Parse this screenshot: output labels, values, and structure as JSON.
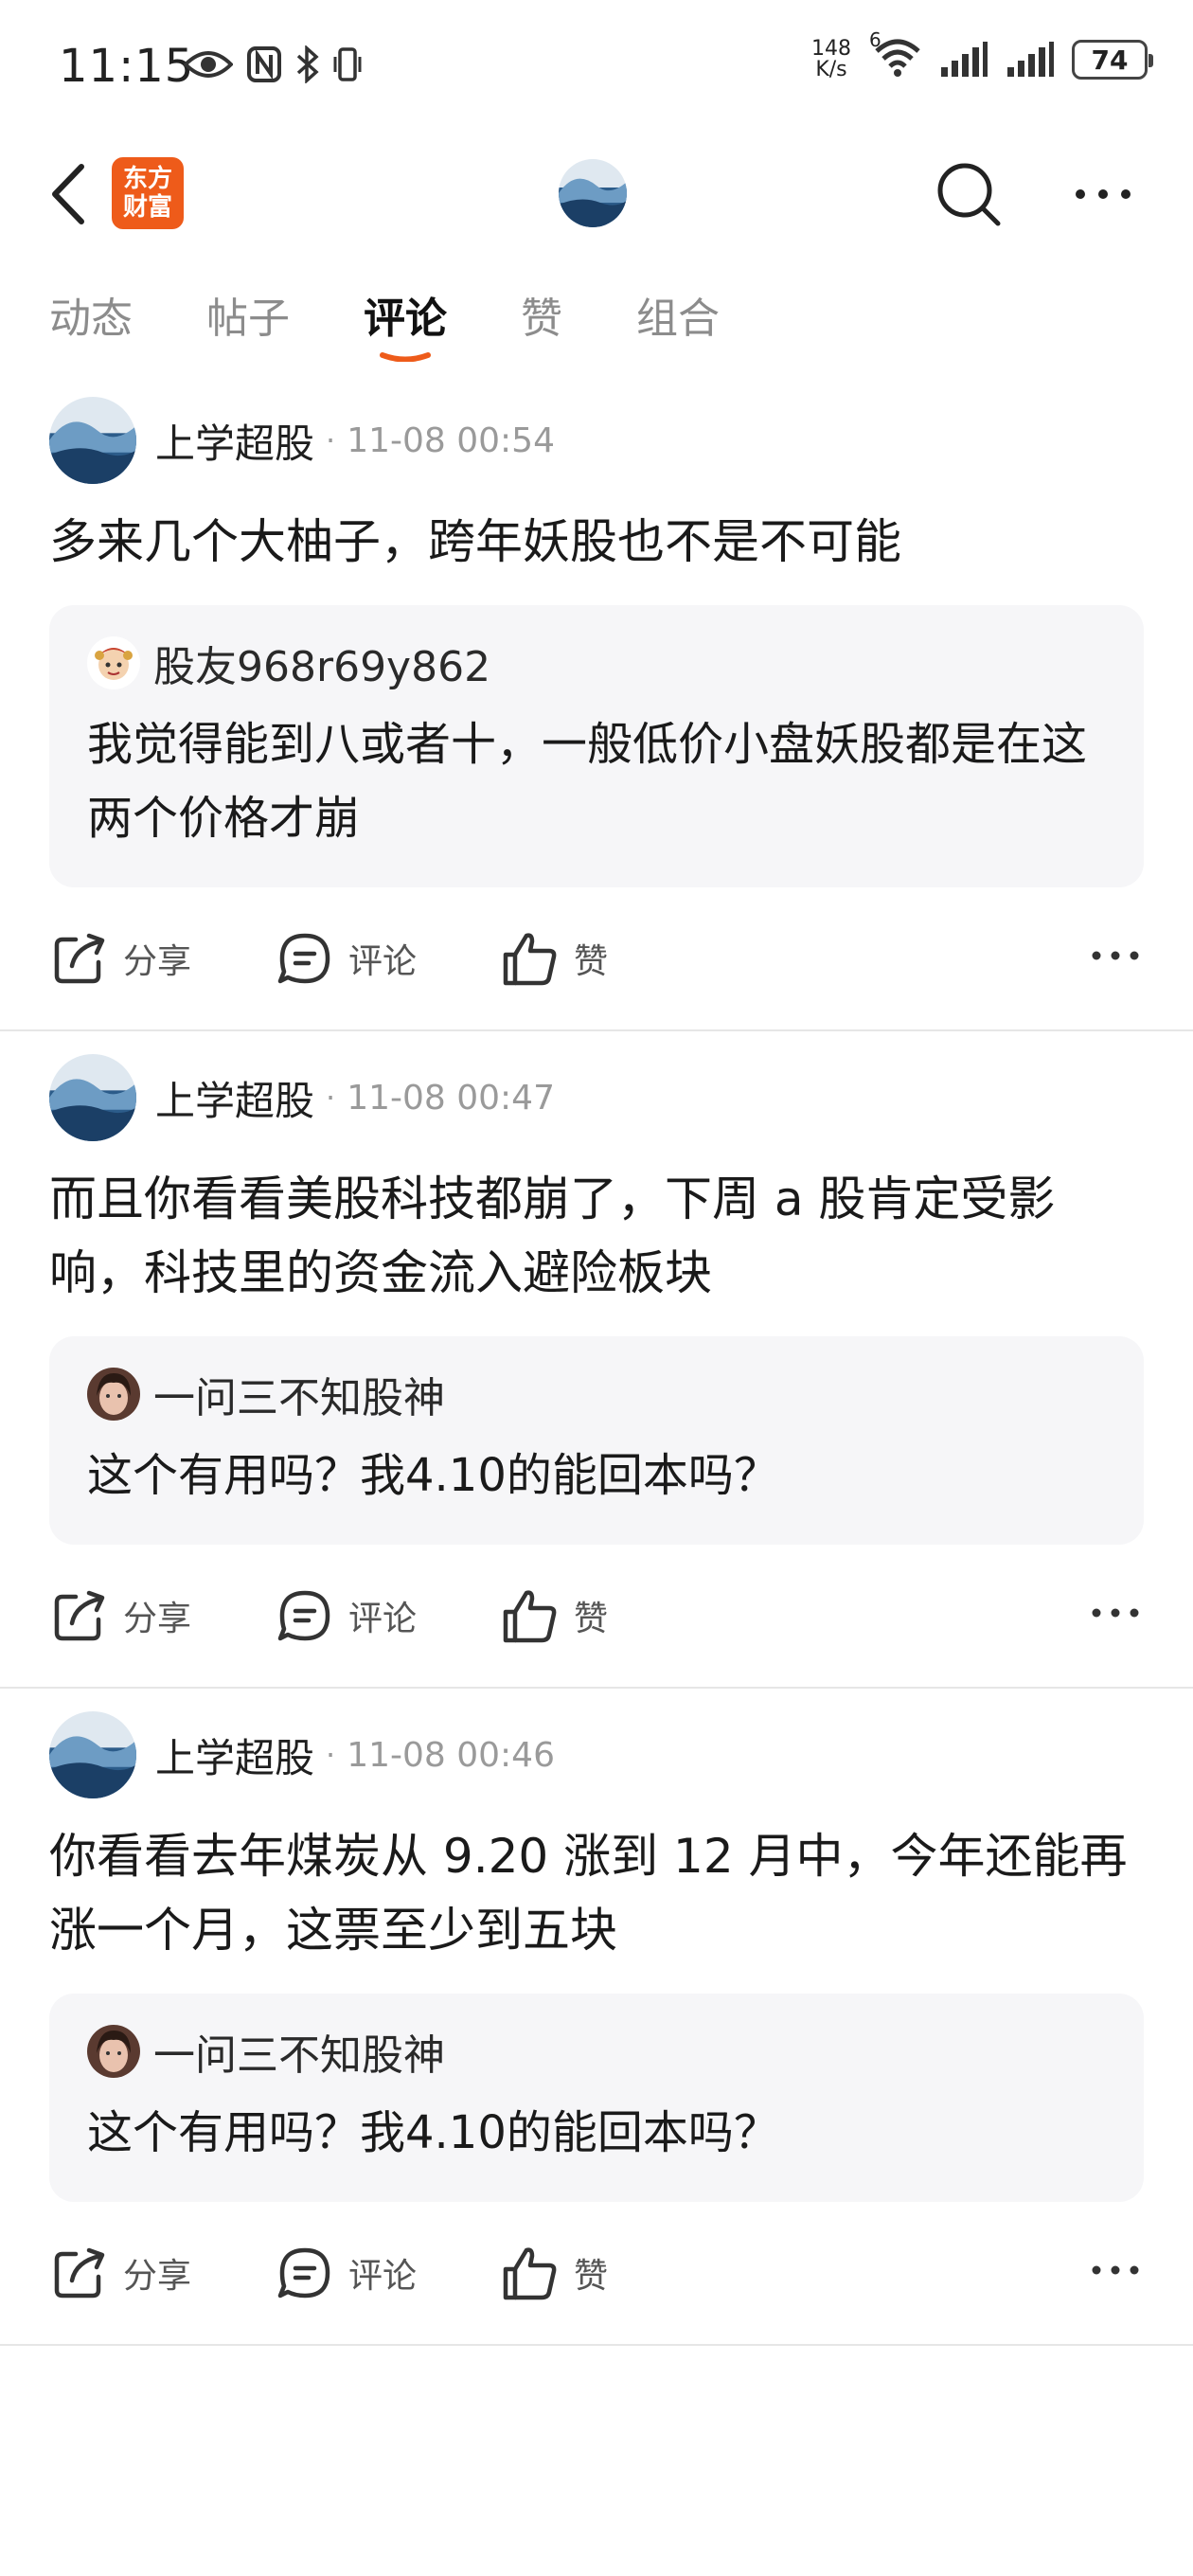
{
  "status_bar": {
    "time": "11:15",
    "net_speed_top": "148",
    "net_speed_bottom": "K/s",
    "wifi_badge": "6",
    "battery": "74"
  },
  "nav": {
    "logo_line1": "东方",
    "logo_line2": "财富"
  },
  "tabs": [
    {
      "label": "动态"
    },
    {
      "label": "帖子"
    },
    {
      "label": "评论"
    },
    {
      "label": "赞"
    },
    {
      "label": "组合"
    }
  ],
  "active_tab": "评论",
  "accent_color": "#ee5b1a",
  "actions": {
    "share": "分享",
    "comment": "评论",
    "like": "赞"
  },
  "posts": [
    {
      "author": "上学超股",
      "dot": "·",
      "time": "11-08 00:54",
      "text": "多来几个大柚子，跨年妖股也不是不可能",
      "quote": {
        "user": "股友968r69y862",
        "text": "我觉得能到八或者十，一般低价小盘妖股都是在这两个价格才崩"
      }
    },
    {
      "author": "上学超股",
      "dot": "·",
      "time": "11-08 00:47",
      "text": "而且你看看美股科技都崩了，下周 a 股肯定受影响，科技里的资金流入避险板块",
      "quote": {
        "user": "一问三不知股神",
        "text": "这个有用吗？我4.10的能回本吗？"
      }
    },
    {
      "author": "上学超股",
      "dot": "·",
      "time": "11-08 00:46",
      "text": "你看看去年煤炭从 9.20 涨到 12 月中，今年还能再涨一个月，这票至少到五块",
      "quote": {
        "user": "一问三不知股神",
        "text": "这个有用吗？我4.10的能回本吗？"
      }
    }
  ]
}
